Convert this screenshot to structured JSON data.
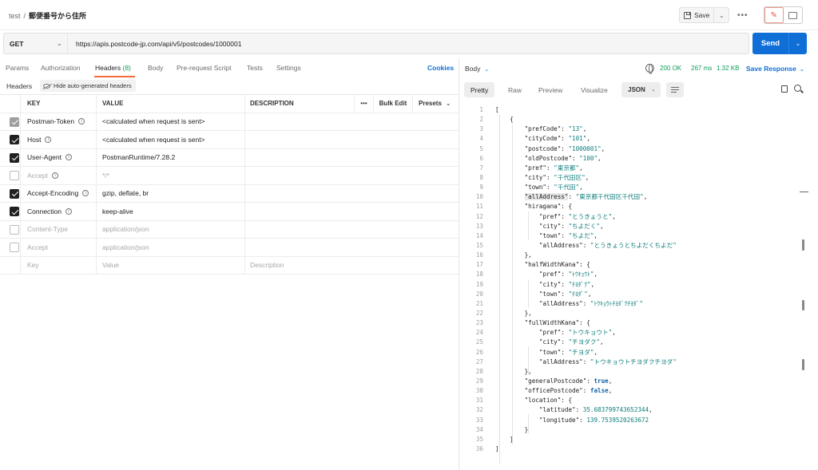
{
  "breadcrumb": {
    "parent": "test",
    "separator": "/",
    "current": "郵便番号から住所"
  },
  "toolbar": {
    "save_label": "Save",
    "more": "•••"
  },
  "request": {
    "method": "GET",
    "url": "https://apis.postcode-jp.com/api/v5/postcodes/1000001",
    "send_label": "Send"
  },
  "tabs": [
    {
      "label": "Params"
    },
    {
      "label": "Authorization"
    },
    {
      "label": "Headers",
      "count": " (8)"
    },
    {
      "label": "Body"
    },
    {
      "label": "Pre-request Script"
    },
    {
      "label": "Tests"
    },
    {
      "label": "Settings"
    }
  ],
  "cookies_label": "Cookies",
  "headers_panel": {
    "title": "Headers",
    "hide_auto_label": "Hide auto-generated headers"
  },
  "table": {
    "columns": {
      "key": "KEY",
      "value": "VALUE",
      "description": "DESCRIPTION",
      "more": "•••",
      "bulk_edit": "Bulk Edit",
      "presets": "Presets"
    },
    "rows": [
      {
        "key": "Postman-Token",
        "value": "<calculated when request is sent>",
        "state": "dis",
        "info": true,
        "muted": false
      },
      {
        "key": "Host",
        "value": "<calculated when request is sent>",
        "state": "on",
        "info": true,
        "muted": false
      },
      {
        "key": "User-Agent",
        "value": "PostmanRuntime/7.28.2",
        "state": "on",
        "info": true,
        "muted": false
      },
      {
        "key": "Accept",
        "value": "*/*",
        "state": "off",
        "info": true,
        "muted": true
      },
      {
        "key": "Accept-Encoding",
        "value": "gzip, deflate, br",
        "state": "on",
        "info": true,
        "muted": false
      },
      {
        "key": "Connection",
        "value": "keep-alive",
        "state": "on",
        "info": true,
        "muted": false
      },
      {
        "key": "Content-Type",
        "value": "application/json",
        "state": "off",
        "info": false,
        "muted": true
      },
      {
        "key": "Accept",
        "value": "application/json",
        "state": "off",
        "info": false,
        "muted": true
      }
    ],
    "placeholders": {
      "key": "Key",
      "value": "Value",
      "description": "Description"
    }
  },
  "response": {
    "body_label": "Body",
    "status": "200 OK",
    "time": "267 ms",
    "size": "1.32 KB",
    "save_label": "Save Response",
    "view_tabs": [
      "Pretty",
      "Raw",
      "Preview",
      "Visualize"
    ],
    "format": "JSON",
    "lines": [
      "[",
      "    {",
      "        \"prefCode\": \"13\",",
      "        \"cityCode\": \"101\",",
      "        \"postcode\": \"1000001\",",
      "        \"oldPostcode\": \"100\",",
      "        \"pref\": \"東京都\",",
      "        \"city\": \"千代田区\",",
      "        \"town\": \"千代田\",",
      "        \"allAddress\": \"東京都千代田区千代田\",",
      "        \"hiragana\": {",
      "            \"pref\": \"とうきょうと\",",
      "            \"city\": \"ちよだく\",",
      "            \"town\": \"ちよだ\",",
      "            \"allAddress\": \"とうきょうとちよだくちよだ\"",
      "        },",
      "        \"halfWidthKana\": {",
      "            \"pref\": \"ﾄｳｷｮｳﾄ\",",
      "            \"city\": \"ﾁﾖﾀﾞｸ\",",
      "            \"town\": \"ﾁﾖﾀﾞ\",",
      "            \"allAddress\": \"ﾄｳｷｮｳﾄﾁﾖﾀﾞｸﾁﾖﾀﾞ\"",
      "        },",
      "        \"fullWidthKana\": {",
      "            \"pref\": \"トウキョウト\",",
      "            \"city\": \"チヨダク\",",
      "            \"town\": \"チヨダ\",",
      "            \"allAddress\": \"トウキョウトチヨダクチヨダ\"",
      "        },",
      "        \"generalPostcode\": true,",
      "        \"officePostcode\": false,",
      "        \"location\": {",
      "            \"latitude\": 35.683799743652344,",
      "            \"longitude\": 139.7539520263672",
      "        }",
      "    }",
      "]"
    ]
  }
}
